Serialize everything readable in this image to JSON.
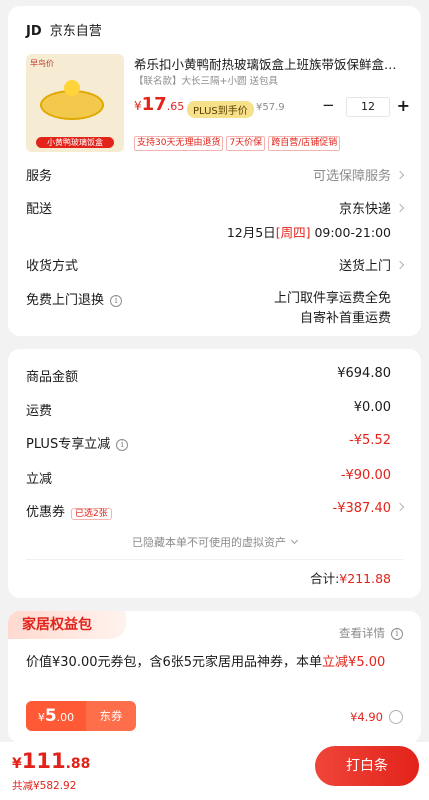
{
  "store": {
    "logo": "JD",
    "name": "京东自营"
  },
  "product": {
    "image_badge": "早鸟价",
    "image_caption": "小黄鸭玻璃饭盒",
    "title": "希乐扣小黄鸭耐热玻璃饭盒上班族带饭保鲜盒…",
    "spec": "【联名款】大长三隔+小圆 送包具",
    "price_symbol": "¥",
    "price_int": "17",
    "price_dec": ".65",
    "plus_badge": "PLUS到手价",
    "orig_price": "¥57.9",
    "qty_minus": "−",
    "qty": "12",
    "qty_plus": "+",
    "tags": [
      "支持30天无理由退货",
      "7天价保",
      "跨自营/店铺促销"
    ]
  },
  "service": {
    "label": "服务",
    "value": "可选保障服务"
  },
  "delivery": {
    "label": "配送",
    "value": "京东快递",
    "time_date": "12月5日",
    "time_day": "[周四]",
    "time_range": "09:00-21:00"
  },
  "pickup": {
    "label": "收货方式",
    "value": "送货上门"
  },
  "return": {
    "label": "免费上门退换",
    "line1": "上门取件享运费全免",
    "line2": "自寄补首重运费"
  },
  "summary": {
    "goods": {
      "label": "商品金额",
      "value": "¥694.80"
    },
    "shipping": {
      "label": "运费",
      "value": "¥0.00"
    },
    "plus": {
      "label": "PLUS专享立减",
      "value": "-¥5.52"
    },
    "discount": {
      "label": "立减",
      "value": "-¥90.00"
    },
    "coupon": {
      "label": "优惠券",
      "badge": "已选2张",
      "value": "-¥387.40"
    },
    "hidden_note": "已隐藏本单不可使用的虚拟资产",
    "total_label": "合计:",
    "total_value": "¥211.88"
  },
  "benefit": {
    "title": "家居权益包",
    "details": "查看详情",
    "desc_main": "价值¥30.00元券包，含6张5元家居用品神券，本单",
    "desc_hl": "立减",
    "desc_amount": "¥5.00",
    "coupon_sym": "¥",
    "coupon_int": "5",
    "coupon_dec": ".00",
    "coupon_type": "东券",
    "price": "¥4.90"
  },
  "footer": {
    "price_sym": "¥",
    "price_int": "111",
    "price_dec": ".88",
    "saved": "共减¥582.92",
    "pay_button": "打白条"
  },
  "colors": {
    "accent": "#e2231a",
    "plus_gold": "#f7e08a",
    "background": "#f2f2f2"
  }
}
